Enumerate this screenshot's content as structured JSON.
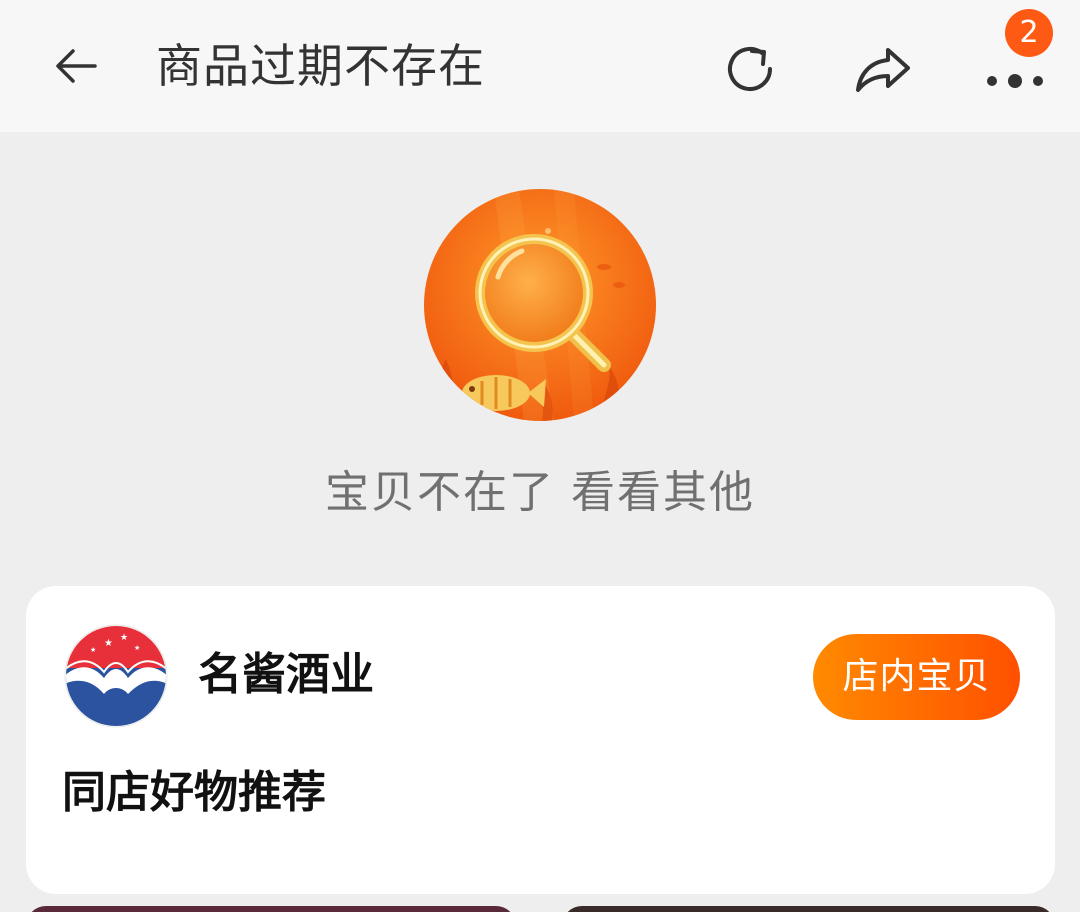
{
  "header": {
    "title": "商品过期不存在",
    "more_badge_count": "2",
    "icons": {
      "back": "arrow-left-icon",
      "refresh": "refresh-icon",
      "share": "share-icon",
      "more": "more-dots-icon"
    }
  },
  "empty_state": {
    "illustration": "magnifier-underwater-icon",
    "message": "宝贝不在了 看看其他"
  },
  "shop": {
    "name": "名酱酒业",
    "button_label": "店内宝贝",
    "logo": "shop-logo-icon"
  },
  "recommend": {
    "title": "同店好物推荐"
  },
  "colors": {
    "accent": "#ff5000",
    "badge": "#ff5a14",
    "background": "#eeeeee"
  }
}
